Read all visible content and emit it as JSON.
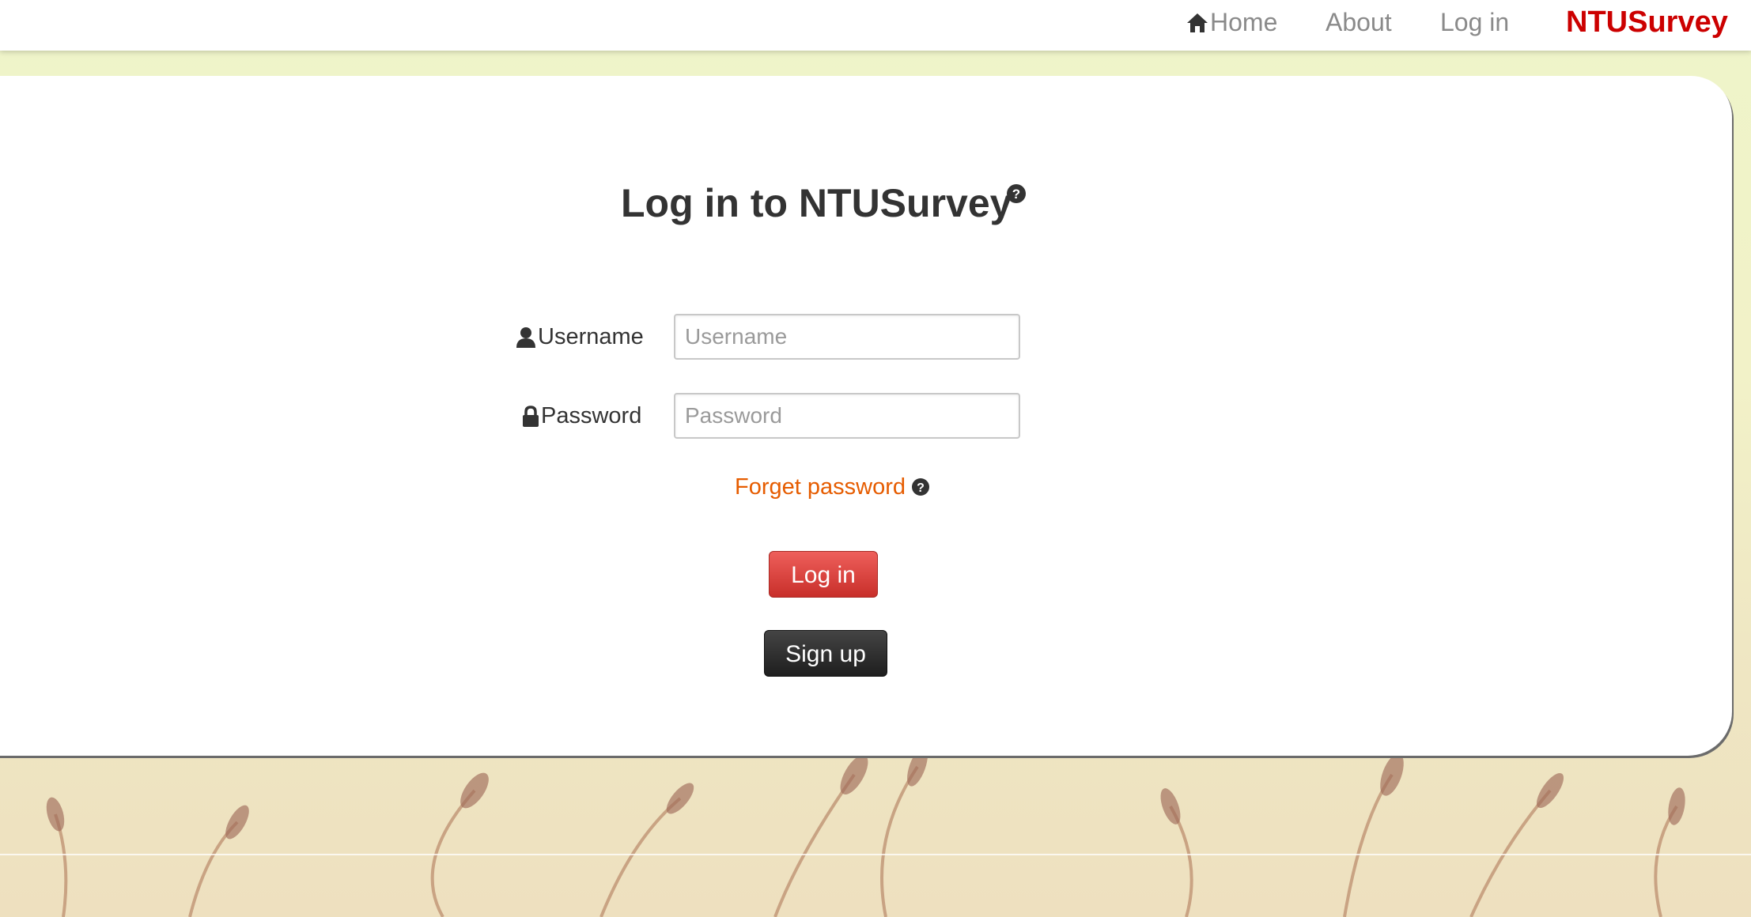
{
  "nav": {
    "home_label": "Home",
    "home_icon": "home-icon",
    "about_label": "About",
    "login_label": "Log in",
    "brand": "NTUSurvey",
    "brand_color": "#cc0000"
  },
  "login_form": {
    "title": "Log in to NTUSurvey",
    "title_help_icon": "question-circle-icon",
    "username": {
      "label": "Username",
      "icon": "user-icon",
      "placeholder": "Username",
      "value": ""
    },
    "password": {
      "label": "Password",
      "icon": "lock-icon",
      "placeholder": "Password",
      "value": ""
    },
    "forgot_password": "Forget password",
    "forgot_help_icon": "question-circle-icon",
    "login_button": "Log in",
    "signup_button": "Sign up",
    "accent_color": "#e65c00"
  }
}
